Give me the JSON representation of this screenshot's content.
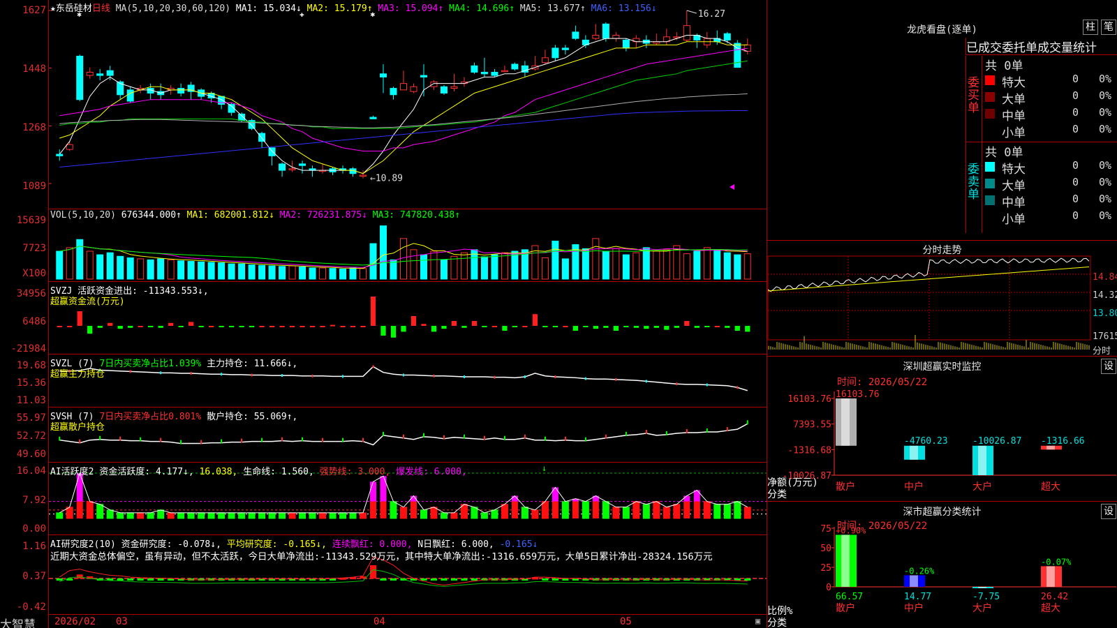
{
  "stock": {
    "star": "★",
    "name": "东岳硅材",
    "period": "日线"
  },
  "ma_header": {
    "params": "MA(5,10,20,30,60,120)",
    "ma1": "MA1: 15.034↓",
    "ma2": "MA2: 15.179↑",
    "ma3": "MA3: 15.094↑",
    "ma4": "MA4: 14.696↑",
    "ma5": "MA5: 13.677↑",
    "ma6": "MA6: 13.156↓"
  },
  "price_axis": [
    "1627",
    "1448",
    "1268",
    "1089"
  ],
  "price_marks": {
    "high": "16.27",
    "low": "10.89"
  },
  "vol_header": {
    "params": "VOL(5,10,20)",
    "vol": "676344.000↑",
    "ma1": "MA1: 682001.812↓",
    "ma2": "MA2: 726231.875↓",
    "ma3": "MA3: 747820.438↑"
  },
  "vol_axis": [
    "15639",
    "7723",
    "X100"
  ],
  "svzj": {
    "line1": "SVZJ  活跃资金进出: -11343.553↓,",
    "line2": "超赢资金流(万元)",
    "axis": [
      "34956",
      "6486",
      "-21984"
    ]
  },
  "svzl": {
    "prefix": "SVZL (7)",
    "p1": "7日内买卖净占比1.039%",
    "p2": "主力持仓: 11.666↓,",
    "line2": "超赢主力持仓",
    "axis": [
      "19.68",
      "15.36",
      "11.03"
    ]
  },
  "svsh": {
    "prefix": "SVSH (7)",
    "p1": "7日内买卖净占比0.801%",
    "p2": "散户持仓: 55.069↑,",
    "line2": "超赢散户持仓",
    "axis": [
      "55.97",
      "52.72",
      "49.60"
    ]
  },
  "ai2": {
    "prefix": "AI活跃度2",
    "p1": "资金活跃度: 4.177↓,",
    "p2": "16.038,",
    "p3": "生命线: 1.560,",
    "p4": "强势线: 3.000,",
    "p5": "爆发线: 6.000,",
    "axis": [
      "16.04",
      "7.92",
      "0.00"
    ]
  },
  "ai3": {
    "prefix": "AI研究度2(10)",
    "p1": "资金研究度: -0.078↓,",
    "p2": "平均研究度: -0.165↓,",
    "p3": "连续飘红: 0.000,",
    "p4": "N日飘红: 6.000,",
    "p5": "-0.165↓",
    "comment": "近期大资金总体偏空，虽有异动，但不太活跃，今日大单净流出:-11343.529万元，其中特大单净流出:-1316.659万元，大单5日累计净出-28324.156万元",
    "axis": [
      "1.16",
      "0.37",
      "-0.42"
    ]
  },
  "date_axis": {
    "brand": "大智慧",
    "labels": [
      "2026/02",
      "03",
      "04",
      "05"
    ]
  },
  "dragon": {
    "title": "龙虎看盘(逐单)",
    "btn1": "柱",
    "btn2": "笔",
    "tabs": [
      "已成交",
      "委托单",
      "成交量",
      "统计"
    ],
    "buy": {
      "label": "委买单",
      "total": "共 0单",
      "rows": [
        {
          "name": "特大",
          "v": "0",
          "p": "0%",
          "color": "#ff0000"
        },
        {
          "name": "大单",
          "v": "0",
          "p": "0%",
          "color": "#8b0000"
        },
        {
          "name": "中单",
          "v": "0",
          "p": "0%",
          "color": "#700000"
        },
        {
          "name": "小单",
          "v": "0",
          "p": "0%",
          "color": "#000000"
        }
      ]
    },
    "sell": {
      "label": "委卖单",
      "total": "共 0单",
      "rows": [
        {
          "name": "特大",
          "v": "0",
          "p": "0%",
          "color": "#00ffff"
        },
        {
          "name": "大单",
          "v": "0",
          "p": "0%",
          "color": "#008b8b"
        },
        {
          "name": "中单",
          "v": "0",
          "p": "0%",
          "color": "#007070"
        },
        {
          "name": "小单",
          "v": "0",
          "p": "0%",
          "color": "#000000"
        }
      ]
    }
  },
  "intraday": {
    "title": "分时走势",
    "axis": [
      "14.84",
      "14.32",
      "13.80",
      "17615",
      "分时"
    ]
  },
  "monitor": {
    "title": "深圳超赢实时监控",
    "btn": "设",
    "time": "时间: 2026/05/22",
    "unit": "净额(万元)",
    "cat_label": "分类",
    "axis": [
      "16103.76",
      "7393.55",
      "-1316.68",
      "-10026.87"
    ]
  },
  "stats": {
    "title": "深市超赢分类统计",
    "btn": "设",
    "time": "时间: 2026/05/22",
    "unit": "比例%",
    "cat_label": "分类",
    "axis": [
      "75",
      "50",
      "25",
      "0"
    ]
  },
  "chart_data": [
    {
      "type": "candlestick",
      "title": "东岳硅材 日线",
      "ylim": [
        10.89,
        16.27
      ],
      "ticks": [
        16.27,
        14.48,
        12.68,
        10.89
      ],
      "candles": [
        [
          11.8,
          11.75,
          11.95,
          11.6
        ],
        [
          11.95,
          12.1,
          12.2,
          11.9
        ],
        [
          14.85,
          13.5,
          14.9,
          13.45
        ],
        [
          14.25,
          14.35,
          14.5,
          14.15
        ],
        [
          14.3,
          14.25,
          14.45,
          14.1
        ],
        [
          14.4,
          14.25,
          14.55,
          14.1
        ],
        [
          14.05,
          13.65,
          14.1,
          13.5
        ],
        [
          13.8,
          13.45,
          13.9,
          13.4
        ],
        [
          13.8,
          13.85,
          13.95,
          13.7
        ],
        [
          13.85,
          13.7,
          14.0,
          13.5
        ],
        [
          13.75,
          13.65,
          14.0,
          13.5
        ],
        [
          13.8,
          13.85,
          13.95,
          13.65
        ],
        [
          13.85,
          13.7,
          14.0,
          13.6
        ],
        [
          13.95,
          13.75,
          14.05,
          13.5
        ],
        [
          13.8,
          13.6,
          13.85,
          13.5
        ],
        [
          13.7,
          13.55,
          13.75,
          13.4
        ],
        [
          13.6,
          13.35,
          13.6,
          13.2
        ],
        [
          13.35,
          13.1,
          13.4,
          13.0
        ],
        [
          13.05,
          12.85,
          13.1,
          12.8
        ],
        [
          12.85,
          12.6,
          12.9,
          12.55
        ],
        [
          12.45,
          12.2,
          12.5,
          12.0
        ],
        [
          12.0,
          11.75,
          12.0,
          11.45
        ],
        [
          11.5,
          11.3,
          11.55,
          11.1
        ],
        [
          11.35,
          11.35,
          11.6,
          11.25
        ],
        [
          11.5,
          11.45,
          11.6,
          11.2
        ],
        [
          11.35,
          11.3,
          11.45,
          11.1
        ],
        [
          11.3,
          11.3,
          11.5,
          11.2
        ],
        [
          11.35,
          11.25,
          11.4,
          11.15
        ],
        [
          11.35,
          11.3,
          11.45,
          11.2
        ],
        [
          11.35,
          11.2,
          11.4,
          11.1
        ],
        [
          11.15,
          11.15,
          11.3,
          11.05
        ],
        [
          12.95,
          12.9,
          13.0,
          12.9
        ],
        [
          14.3,
          14.2,
          14.6,
          13.7
        ],
        [
          13.85,
          13.65,
          13.9,
          13.5
        ],
        [
          13.8,
          14.0,
          14.4,
          13.8
        ],
        [
          13.75,
          13.9,
          14.0,
          13.7
        ],
        [
          14.25,
          14.2,
          14.6,
          13.6
        ],
        [
          13.9,
          14.05,
          14.1,
          13.8
        ],
        [
          13.9,
          13.7,
          13.95,
          13.65
        ],
        [
          13.85,
          13.9,
          14.3,
          13.75
        ],
        [
          14.0,
          14.05,
          14.2,
          13.9
        ],
        [
          14.55,
          14.35,
          14.65,
          14.3
        ],
        [
          14.35,
          14.3,
          14.8,
          14.2
        ],
        [
          14.35,
          14.25,
          14.45,
          14.2
        ],
        [
          14.4,
          14.4,
          14.55,
          14.35
        ],
        [
          14.6,
          14.45,
          14.65,
          14.4
        ],
        [
          14.55,
          14.35,
          14.7,
          14.2
        ],
        [
          14.45,
          14.55,
          14.85,
          14.4
        ],
        [
          14.65,
          14.8,
          15.05,
          14.6
        ],
        [
          15.1,
          14.8,
          15.2,
          14.7
        ],
        [
          15.1,
          15.05,
          15.2,
          14.9
        ],
        [
          15.6,
          15.4,
          15.8,
          15.35
        ],
        [
          15.35,
          15.2,
          15.5,
          15.1
        ],
        [
          15.4,
          15.5,
          15.85,
          15.35
        ],
        [
          15.85,
          15.4,
          15.9,
          15.3
        ],
        [
          15.4,
          15.5,
          15.6,
          15.3
        ],
        [
          15.35,
          15.1,
          15.4,
          15.0
        ],
        [
          15.3,
          15.4,
          15.5,
          15.1
        ],
        [
          15.35,
          15.25,
          15.5,
          15.1
        ],
        [
          15.25,
          15.3,
          15.55,
          15.2
        ],
        [
          15.3,
          15.45,
          15.7,
          15.2
        ],
        [
          15.45,
          15.45,
          15.6,
          15.35
        ],
        [
          15.35,
          15.8,
          16.27,
          15.3
        ],
        [
          15.5,
          15.35,
          15.55,
          15.1
        ],
        [
          15.2,
          15.4,
          15.6,
          15.1
        ],
        [
          15.4,
          15.3,
          15.65,
          15.2
        ],
        [
          15.55,
          15.35,
          15.6,
          15.25
        ],
        [
          15.25,
          14.5,
          15.35,
          14.5
        ],
        [
          15.0,
          15.2,
          15.4,
          14.9
        ]
      ],
      "ma_series": [
        {
          "name": "MA1",
          "color": "#ffffff",
          "values": [
            11.8,
            12.2,
            12.9,
            13.6,
            14.0,
            14.2,
            14.0,
            13.9,
            13.8,
            13.8,
            13.7,
            13.8,
            13.8,
            13.8,
            13.7,
            13.6,
            13.5,
            13.3,
            13.0,
            12.7,
            12.3,
            11.9,
            11.6,
            11.4,
            11.3,
            11.3,
            11.3,
            11.3,
            11.3,
            11.3,
            11.2,
            11.5,
            11.9,
            12.4,
            12.8,
            13.2,
            13.8,
            14.0,
            14.0,
            14.0,
            14.0,
            14.1,
            14.2,
            14.2,
            14.3,
            14.3,
            14.4,
            14.5,
            14.6,
            14.7,
            14.8,
            15.0,
            15.2,
            15.3,
            15.4,
            15.4,
            15.4,
            15.3,
            15.3,
            15.3,
            15.3,
            15.4,
            15.5,
            15.5,
            15.4,
            15.4,
            15.3,
            15.1,
            15.0
          ]
        },
        {
          "name": "MA2",
          "color": "#ffff00",
          "values": [
            12.3,
            12.4,
            12.6,
            12.8,
            13.0,
            13.3,
            13.5,
            13.7,
            13.8,
            13.9,
            13.9,
            13.8,
            13.8,
            13.8,
            13.7,
            13.7,
            13.6,
            13.5,
            13.3,
            13.1,
            12.9,
            12.6,
            12.3,
            12.0,
            11.8,
            11.6,
            11.5,
            11.4,
            11.3,
            11.3,
            11.2,
            11.4,
            11.6,
            11.9,
            12.2,
            12.5,
            12.7,
            12.9,
            13.1,
            13.3,
            13.5,
            13.7,
            13.8,
            13.9,
            14.0,
            14.1,
            14.2,
            14.3,
            14.4,
            14.5,
            14.6,
            14.7,
            14.8,
            14.9,
            15.0,
            15.1,
            15.1,
            15.1,
            15.2,
            15.2,
            15.2,
            15.2,
            15.3,
            15.3,
            15.3,
            15.3,
            15.2,
            15.2,
            15.2
          ]
        },
        {
          "name": "MA3",
          "color": "#ff00ff",
          "values": [
            13.0,
            13.05,
            13.1,
            13.15,
            13.2,
            13.3,
            13.35,
            13.4,
            13.45,
            13.5,
            13.5,
            13.5,
            13.5,
            13.5,
            13.5,
            13.45,
            13.4,
            13.4,
            13.3,
            13.2,
            13.0,
            12.9,
            12.8,
            12.6,
            12.5,
            12.3,
            12.2,
            12.1,
            12.0,
            11.95,
            11.9,
            11.9,
            11.9,
            12.0,
            12.0,
            12.1,
            12.15,
            12.2,
            12.3,
            12.4,
            12.5,
            12.6,
            12.7,
            12.8,
            13.0,
            13.1,
            13.3,
            13.5,
            13.6,
            13.7,
            13.8,
            13.9,
            14.0,
            14.1,
            14.2,
            14.3,
            14.4,
            14.5,
            14.6,
            14.65,
            14.7,
            14.75,
            14.8,
            14.85,
            14.9,
            14.95,
            15.0,
            15.05,
            15.09
          ]
        },
        {
          "name": "MA4",
          "color": "#00d000",
          "values": [
            12.7,
            12.75,
            12.75,
            12.8,
            12.8,
            12.85,
            12.85,
            12.9,
            12.9,
            12.9,
            12.9,
            12.9,
            12.9,
            12.9,
            12.9,
            12.9,
            12.9,
            12.9,
            12.85,
            12.8,
            12.8,
            12.75,
            12.75,
            12.7,
            12.7,
            12.65,
            12.65,
            12.6,
            12.6,
            12.6,
            12.6,
            12.6,
            12.6,
            12.6,
            12.62,
            12.65,
            12.68,
            12.7,
            12.72,
            12.75,
            12.78,
            12.8,
            12.85,
            12.9,
            12.95,
            13.0,
            13.05,
            13.1,
            13.2,
            13.3,
            13.4,
            13.5,
            13.6,
            13.7,
            13.8,
            13.9,
            14.0,
            14.1,
            14.15,
            14.2,
            14.25,
            14.3,
            14.4,
            14.45,
            14.5,
            14.55,
            14.6,
            14.65,
            14.7
          ]
        },
        {
          "name": "MA5",
          "color": "#b0b0b0",
          "values": [
            12.75,
            12.78,
            12.8,
            12.82,
            12.83,
            12.85,
            12.86,
            12.87,
            12.88,
            12.88,
            12.88,
            12.87,
            12.86,
            12.85,
            12.84,
            12.83,
            12.82,
            12.81,
            12.8,
            12.79,
            12.77,
            12.75,
            12.73,
            12.71,
            12.69,
            12.67,
            12.66,
            12.65,
            12.64,
            12.63,
            12.62,
            12.62,
            12.63,
            12.64,
            12.66,
            12.68,
            12.7,
            12.72,
            12.75,
            12.78,
            12.81,
            12.84,
            12.87,
            12.9,
            12.93,
            12.96,
            13.0,
            13.04,
            13.08,
            13.12,
            13.16,
            13.2,
            13.24,
            13.28,
            13.32,
            13.36,
            13.4,
            13.44,
            13.47,
            13.5,
            13.53,
            13.55,
            13.58,
            13.6,
            13.62,
            13.64,
            13.65,
            13.66,
            13.68
          ]
        },
        {
          "name": "MA6",
          "color": "#3030ff",
          "values": [
            11.4,
            11.43,
            11.46,
            11.49,
            11.52,
            11.55,
            11.58,
            11.61,
            11.64,
            11.67,
            11.7,
            11.73,
            11.76,
            11.79,
            11.82,
            11.85,
            11.88,
            11.91,
            11.94,
            11.97,
            12.0,
            12.03,
            12.06,
            12.09,
            12.12,
            12.15,
            12.18,
            12.21,
            12.24,
            12.27,
            12.3,
            12.33,
            12.36,
            12.39,
            12.42,
            12.45,
            12.48,
            12.51,
            12.54,
            12.57,
            12.6,
            12.63,
            12.66,
            12.69,
            12.72,
            12.75,
            12.78,
            12.81,
            12.84,
            12.87,
            12.9,
            12.93,
            12.96,
            12.99,
            13.02,
            13.05,
            13.07,
            13.09,
            13.1,
            13.11,
            13.12,
            13.13,
            13.14,
            13.145,
            13.15,
            13.15,
            13.155,
            13.156,
            13.156
          ]
        }
      ]
    },
    {
      "type": "bar",
      "title": "深圳超赢实时监控",
      "ylabel": "净额(万元)",
      "categories": [
        "散户",
        "中户",
        "大户",
        "超大"
      ],
      "values": [
        16103.76,
        -4760.23,
        -10026.87,
        -1316.66
      ],
      "ylim": [
        -10026.87,
        16103.76
      ]
    },
    {
      "type": "bar",
      "title": "深市超赢分类统计",
      "ylabel": "比例%",
      "categories": [
        "散户",
        "中户",
        "大户",
        "超大"
      ],
      "values": [
        66.57,
        14.77,
        -7.75,
        26.42
      ],
      "changes": [
        "+0.90%",
        "-0.26%",
        "",
        "-0.07%"
      ],
      "ylim": [
        0,
        75
      ]
    }
  ]
}
